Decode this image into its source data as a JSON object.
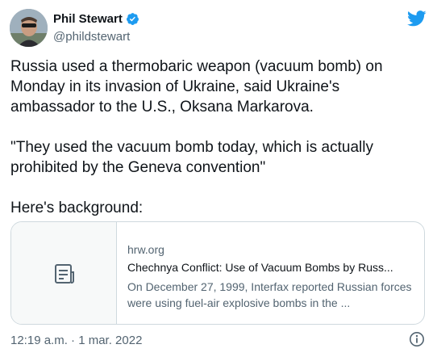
{
  "author": {
    "name": "Phil Stewart",
    "handle": "@phildstewart",
    "verified": true
  },
  "tweet": {
    "text": "Russia used a thermobaric weapon (vacuum bomb) on Monday in its invasion of Ukraine, said Ukraine's ambassador to the U.S., Oksana Markarova.\n\n\"They used the vacuum bomb today, which is actually prohibited by the Geneva convention\"\n\nHere's background:",
    "timestamp": "12:19 a.m. · 1 mar. 2022"
  },
  "link_card": {
    "domain": "hrw.org",
    "title": "Chechnya Conflict: Use of Vacuum Bombs by Russ...",
    "description": "On December 27, 1999, Interfax reported Russian forces were using fuel-air explosive bombs in the ..."
  },
  "icons": {
    "brand": "twitter-bird-icon",
    "verified": "verified-badge-icon",
    "link_thumb": "document-icon",
    "info": "info-icon"
  },
  "colors": {
    "brand_blue": "#1d9bf0",
    "text_primary": "#0f1419",
    "text_secondary": "#536471",
    "border": "#cfd9de"
  }
}
